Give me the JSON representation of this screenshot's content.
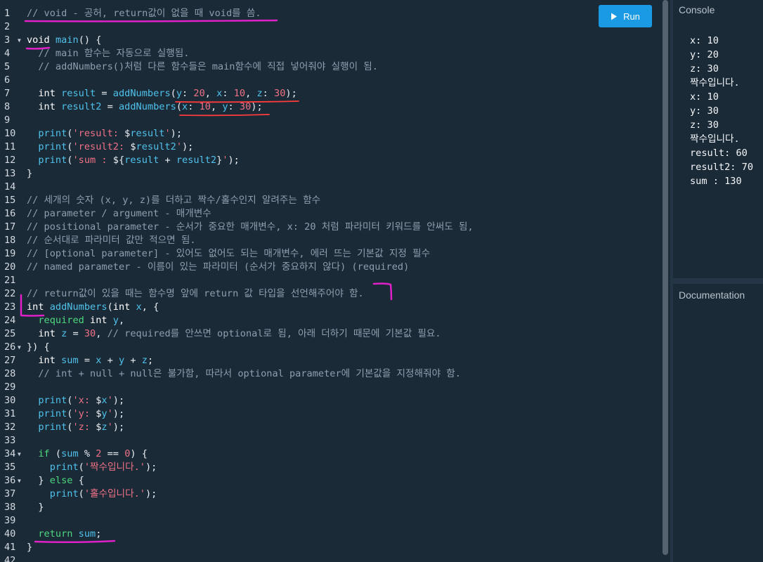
{
  "toolbar": {
    "run_label": "Run",
    "run_icon": "play-icon"
  },
  "console": {
    "title": "Console",
    "lines": [
      "x: 10",
      "y: 20",
      "z: 30",
      "짝수입니다.",
      "x: 10",
      "y: 30",
      "z: 30",
      "짝수입니다.",
      "result: 60",
      "result2: 70",
      "sum : 130"
    ]
  },
  "documentation": {
    "title": "Documentation"
  },
  "colors": {
    "background": "#1b2a37",
    "run_button": "#1a9ae3",
    "annotation_pink": "#e020c8",
    "annotation_red": "#ff3b3b"
  },
  "editor": {
    "lines": [
      {
        "n": "1",
        "fold": false,
        "tokens": [
          [
            "com",
            "// void - 공허, return값이 없을 때 void를 씀."
          ]
        ]
      },
      {
        "n": "2",
        "fold": false,
        "tokens": []
      },
      {
        "n": "3",
        "fold": true,
        "tokens": [
          [
            "kw",
            "void"
          ],
          [
            "op",
            " "
          ],
          [
            "fn",
            "main"
          ],
          [
            "op",
            "() {"
          ]
        ]
      },
      {
        "n": "4",
        "fold": false,
        "tokens": [
          [
            "op",
            "  "
          ],
          [
            "com",
            "// main 함수는 자동으로 실행됨."
          ]
        ]
      },
      {
        "n": "5",
        "fold": false,
        "tokens": [
          [
            "op",
            "  "
          ],
          [
            "com",
            "// addNumbers()처럼 다른 함수들은 main함수에 직접 넣어줘야 실행이 됨."
          ]
        ]
      },
      {
        "n": "6",
        "fold": false,
        "tokens": []
      },
      {
        "n": "7",
        "fold": false,
        "tokens": [
          [
            "op",
            "  "
          ],
          [
            "kw",
            "int"
          ],
          [
            "op",
            " "
          ],
          [
            "var",
            "result"
          ],
          [
            "op",
            " = "
          ],
          [
            "fn",
            "addNumbers"
          ],
          [
            "op",
            "("
          ],
          [
            "var",
            "y"
          ],
          [
            "op",
            ": "
          ],
          [
            "num",
            "20"
          ],
          [
            "op",
            ", "
          ],
          [
            "var",
            "x"
          ],
          [
            "op",
            ": "
          ],
          [
            "num",
            "10"
          ],
          [
            "op",
            ", "
          ],
          [
            "var",
            "z"
          ],
          [
            "op",
            ": "
          ],
          [
            "num",
            "30"
          ],
          [
            "op",
            ");"
          ]
        ]
      },
      {
        "n": "8",
        "fold": false,
        "tokens": [
          [
            "op",
            "  "
          ],
          [
            "kw",
            "int"
          ],
          [
            "op",
            " "
          ],
          [
            "var",
            "result2"
          ],
          [
            "op",
            " = "
          ],
          [
            "fn",
            "addNumbers"
          ],
          [
            "op",
            "("
          ],
          [
            "var",
            "x"
          ],
          [
            "op",
            ": "
          ],
          [
            "num",
            "10"
          ],
          [
            "op",
            ", "
          ],
          [
            "var",
            "y"
          ],
          [
            "op",
            ": "
          ],
          [
            "num",
            "30"
          ],
          [
            "op",
            ");"
          ]
        ]
      },
      {
        "n": "9",
        "fold": false,
        "tokens": []
      },
      {
        "n": "10",
        "fold": false,
        "tokens": [
          [
            "op",
            "  "
          ],
          [
            "fn",
            "print"
          ],
          [
            "op",
            "("
          ],
          [
            "str",
            "'result: "
          ],
          [
            "op",
            "$"
          ],
          [
            "var",
            "result"
          ],
          [
            "str",
            "'"
          ],
          [
            "op",
            ");"
          ]
        ]
      },
      {
        "n": "11",
        "fold": false,
        "tokens": [
          [
            "op",
            "  "
          ],
          [
            "fn",
            "print"
          ],
          [
            "op",
            "("
          ],
          [
            "str",
            "'result2: "
          ],
          [
            "op",
            "$"
          ],
          [
            "var",
            "result2"
          ],
          [
            "str",
            "'"
          ],
          [
            "op",
            ");"
          ]
        ]
      },
      {
        "n": "12",
        "fold": false,
        "tokens": [
          [
            "op",
            "  "
          ],
          [
            "fn",
            "print"
          ],
          [
            "op",
            "("
          ],
          [
            "str",
            "'sum : "
          ],
          [
            "op",
            "${"
          ],
          [
            "var",
            "result"
          ],
          [
            "op",
            " + "
          ],
          [
            "var",
            "result2"
          ],
          [
            "op",
            "}"
          ],
          [
            "str",
            "'"
          ],
          [
            "op",
            ");"
          ]
        ]
      },
      {
        "n": "13",
        "fold": false,
        "tokens": [
          [
            "op",
            "}"
          ]
        ]
      },
      {
        "n": "14",
        "fold": false,
        "tokens": []
      },
      {
        "n": "15",
        "fold": false,
        "tokens": [
          [
            "com",
            "// 세개의 숫자 (x, y, z)를 더하고 짝수/홀수인지 알려주는 함수"
          ]
        ]
      },
      {
        "n": "16",
        "fold": false,
        "tokens": [
          [
            "com",
            "// parameter / argument - 매개변수"
          ]
        ]
      },
      {
        "n": "17",
        "fold": false,
        "tokens": [
          [
            "com",
            "// positional parameter - 순서가 중요한 매개변수, x: 20 처럼 파라미터 키워드를 안써도 됨,"
          ]
        ]
      },
      {
        "n": "18",
        "fold": false,
        "tokens": [
          [
            "com",
            "// 순서대로 파라미터 값만 적으면 됨."
          ]
        ]
      },
      {
        "n": "19",
        "fold": false,
        "tokens": [
          [
            "com",
            "// [optional parameter] - 있어도 없어도 되는 매개변수, 에러 뜨는 기본값 지정 필수"
          ]
        ]
      },
      {
        "n": "20",
        "fold": false,
        "tokens": [
          [
            "com",
            "// named parameter - 이름이 있는 파라미터 (순서가 중요하지 않다) (required)"
          ]
        ]
      },
      {
        "n": "21",
        "fold": false,
        "tokens": []
      },
      {
        "n": "22",
        "fold": false,
        "tokens": [
          [
            "com",
            "// return값이 있을 때는 함수명 앞에 return 값 타입을 선언해주어야 함."
          ]
        ]
      },
      {
        "n": "23",
        "fold": false,
        "tokens": [
          [
            "kw",
            "int"
          ],
          [
            "op",
            " "
          ],
          [
            "fn",
            "addNumbers"
          ],
          [
            "op",
            "("
          ],
          [
            "kw",
            "int"
          ],
          [
            "op",
            " "
          ],
          [
            "var",
            "x"
          ],
          [
            "op",
            ", {"
          ]
        ]
      },
      {
        "n": "24",
        "fold": false,
        "tokens": [
          [
            "op",
            "  "
          ],
          [
            "grn",
            "required"
          ],
          [
            "op",
            " "
          ],
          [
            "kw",
            "int"
          ],
          [
            "op",
            " "
          ],
          [
            "var",
            "y"
          ],
          [
            "op",
            ","
          ]
        ]
      },
      {
        "n": "25",
        "fold": false,
        "tokens": [
          [
            "op",
            "  "
          ],
          [
            "kw",
            "int"
          ],
          [
            "op",
            " "
          ],
          [
            "var",
            "z"
          ],
          [
            "op",
            " = "
          ],
          [
            "num",
            "30"
          ],
          [
            "op",
            ", "
          ],
          [
            "com",
            "// required를 안쓰면 optional로 됨, 아래 더하기 때문에 기본값 필요."
          ]
        ]
      },
      {
        "n": "26",
        "fold": true,
        "tokens": [
          [
            "op",
            "}) {"
          ]
        ]
      },
      {
        "n": "27",
        "fold": false,
        "tokens": [
          [
            "op",
            "  "
          ],
          [
            "kw",
            "int"
          ],
          [
            "op",
            " "
          ],
          [
            "var",
            "sum"
          ],
          [
            "op",
            " = "
          ],
          [
            "var",
            "x"
          ],
          [
            "op",
            " + "
          ],
          [
            "var",
            "y"
          ],
          [
            "op",
            " + "
          ],
          [
            "var",
            "z"
          ],
          [
            "op",
            ";"
          ]
        ]
      },
      {
        "n": "28",
        "fold": false,
        "tokens": [
          [
            "op",
            "  "
          ],
          [
            "com",
            "// int + null + null은 불가함, 따라서 optional parameter에 기본값을 지정해줘야 함."
          ]
        ]
      },
      {
        "n": "29",
        "fold": false,
        "tokens": []
      },
      {
        "n": "30",
        "fold": false,
        "tokens": [
          [
            "op",
            "  "
          ],
          [
            "fn",
            "print"
          ],
          [
            "op",
            "("
          ],
          [
            "str",
            "'x: "
          ],
          [
            "op",
            "$"
          ],
          [
            "var",
            "x"
          ],
          [
            "str",
            "'"
          ],
          [
            "op",
            ");"
          ]
        ]
      },
      {
        "n": "31",
        "fold": false,
        "tokens": [
          [
            "op",
            "  "
          ],
          [
            "fn",
            "print"
          ],
          [
            "op",
            "("
          ],
          [
            "str",
            "'y: "
          ],
          [
            "op",
            "$"
          ],
          [
            "var",
            "y"
          ],
          [
            "str",
            "'"
          ],
          [
            "op",
            ");"
          ]
        ]
      },
      {
        "n": "32",
        "fold": false,
        "tokens": [
          [
            "op",
            "  "
          ],
          [
            "fn",
            "print"
          ],
          [
            "op",
            "("
          ],
          [
            "str",
            "'z: "
          ],
          [
            "op",
            "$"
          ],
          [
            "var",
            "z"
          ],
          [
            "str",
            "'"
          ],
          [
            "op",
            ");"
          ]
        ]
      },
      {
        "n": "33",
        "fold": false,
        "tokens": []
      },
      {
        "n": "34",
        "fold": true,
        "tokens": [
          [
            "op",
            "  "
          ],
          [
            "grn",
            "if"
          ],
          [
            "op",
            " ("
          ],
          [
            "var",
            "sum"
          ],
          [
            "op",
            " % "
          ],
          [
            "num",
            "2"
          ],
          [
            "op",
            " == "
          ],
          [
            "num",
            "0"
          ],
          [
            "op",
            ") {"
          ]
        ]
      },
      {
        "n": "35",
        "fold": false,
        "tokens": [
          [
            "op",
            "    "
          ],
          [
            "fn",
            "print"
          ],
          [
            "op",
            "("
          ],
          [
            "str",
            "'짝수입니다.'"
          ],
          [
            "op",
            ");"
          ]
        ]
      },
      {
        "n": "36",
        "fold": true,
        "tokens": [
          [
            "op",
            "  } "
          ],
          [
            "grn",
            "else"
          ],
          [
            "op",
            " {"
          ]
        ]
      },
      {
        "n": "37",
        "fold": false,
        "tokens": [
          [
            "op",
            "    "
          ],
          [
            "fn",
            "print"
          ],
          [
            "op",
            "("
          ],
          [
            "str",
            "'홀수입니다.'"
          ],
          [
            "op",
            ");"
          ]
        ]
      },
      {
        "n": "38",
        "fold": false,
        "tokens": [
          [
            "op",
            "  }"
          ]
        ]
      },
      {
        "n": "39",
        "fold": false,
        "tokens": []
      },
      {
        "n": "40",
        "fold": false,
        "tokens": [
          [
            "op",
            "  "
          ],
          [
            "grn",
            "return"
          ],
          [
            "op",
            " "
          ],
          [
            "var",
            "sum"
          ],
          [
            "op",
            ";"
          ]
        ]
      },
      {
        "n": "41",
        "fold": false,
        "tokens": [
          [
            "op",
            "}"
          ]
        ]
      },
      {
        "n": "42",
        "fold": false,
        "tokens": []
      }
    ]
  }
}
